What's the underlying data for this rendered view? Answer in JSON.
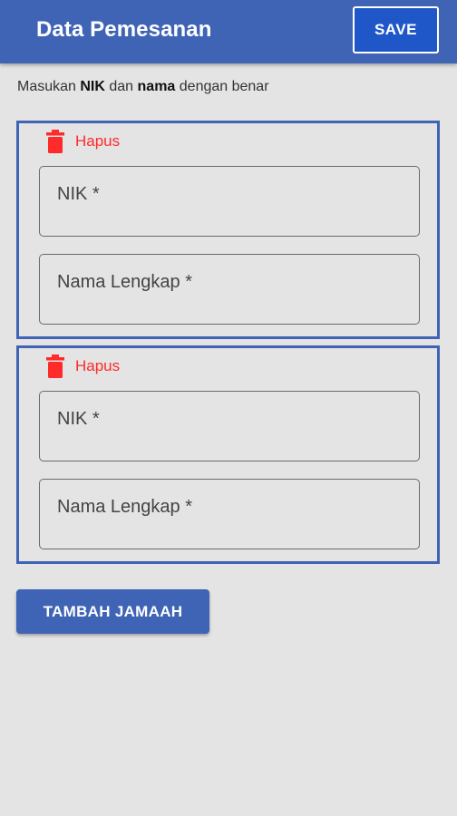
{
  "appbar": {
    "title": "Data Pemesanan",
    "save_label": "SAVE"
  },
  "instruction": {
    "prefix": "Masukan ",
    "bold1": "NIK",
    "middle": " dan ",
    "bold2": "nama",
    "suffix": " dengan benar"
  },
  "entries": [
    {
      "delete_label": "Hapus",
      "nik_placeholder": "NIK *",
      "name_placeholder": "Nama Lengkap *"
    },
    {
      "delete_label": "Hapus",
      "nik_placeholder": "NIK *",
      "name_placeholder": "Nama Lengkap *"
    }
  ],
  "add_button_label": "TAMBAH JAMAAH",
  "colors": {
    "primary": "#3f64b5",
    "save_button": "#1f57c9",
    "delete": "#ff2a2a",
    "background": "#e4e4e4"
  },
  "icons": {
    "delete": "trash-icon"
  }
}
